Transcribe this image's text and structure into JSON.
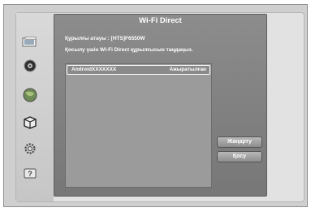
{
  "dialog": {
    "title": "Wi-Fi Direct",
    "device_name_line": "Құрылғы атауы : [HTS]F6550W",
    "instruction_line": "Қосылу үшін Wi-Fi Direct құрылғысын таңдаңыз."
  },
  "devices": [
    {
      "name": "AndroidXXXXXXX",
      "status": "Ажыратылған"
    }
  ],
  "buttons": {
    "refresh_label": "Жаңарту",
    "connect_label": "Қосу"
  },
  "sidebar": {
    "icons": [
      "photos-icon",
      "music-disc-icon",
      "globe-icon",
      "box-icon",
      "settings-gear-icon",
      "help-icon"
    ]
  }
}
